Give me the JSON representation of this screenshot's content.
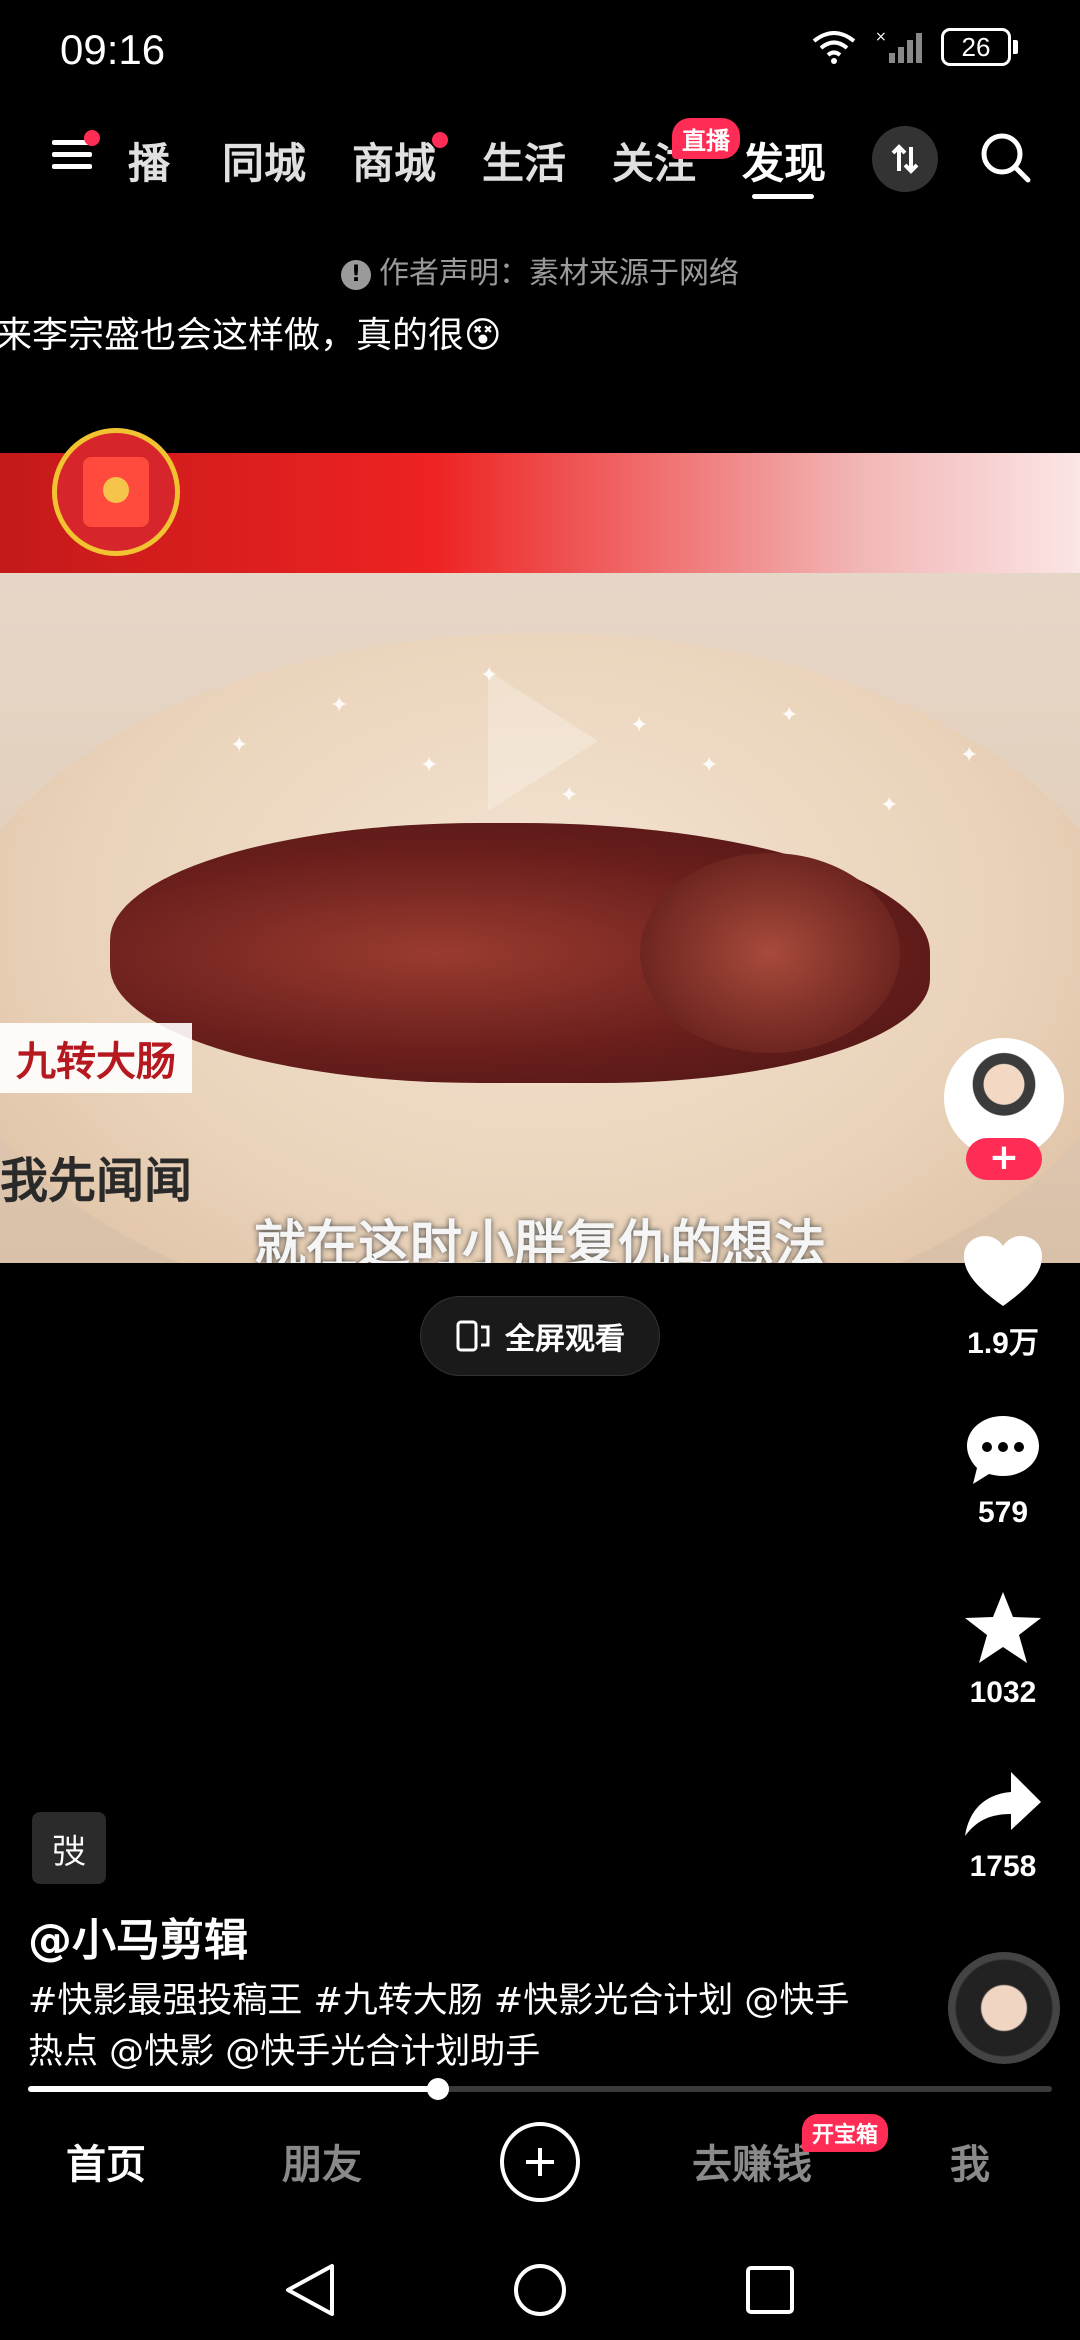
{
  "status": {
    "time": "09:16",
    "battery": "26"
  },
  "top_nav": {
    "tabs": [
      {
        "label": "播",
        "has_dot": false
      },
      {
        "label": "同城",
        "has_dot": false
      },
      {
        "label": "商城",
        "has_dot": true
      },
      {
        "label": "生活",
        "has_dot": false
      },
      {
        "label": "关注",
        "has_dot": false
      },
      {
        "label": "发现",
        "has_dot": false
      }
    ],
    "live_badge": "直播",
    "active_tab": "发现"
  },
  "notice": {
    "icon": "!",
    "text": "作者声明：素材来源于网络"
  },
  "video": {
    "title": "来李宗盛也会这样做，真的很😵",
    "caption_label": "九转大肠",
    "caption_left": "我先闻闻",
    "subtitle": "就在这时小胖复仇的想法"
  },
  "fullscreen_label": "全屏观看",
  "actions": {
    "likes": "1.9万",
    "comments": "579",
    "favorites": "1032",
    "shares": "1758",
    "follow_symbol": "+"
  },
  "post": {
    "tag_chip": "弢",
    "author": "@小马剪辑",
    "description": "#快影最强投稿王 #九转大肠 #快影光合计划 @快手热点 @快影 @快手光合计划助手",
    "progress": 0.4
  },
  "tab_bar": {
    "home": "首页",
    "friends": "朋友",
    "earn": "去赚钱",
    "earn_badge": "开宝箱",
    "me": "我"
  }
}
